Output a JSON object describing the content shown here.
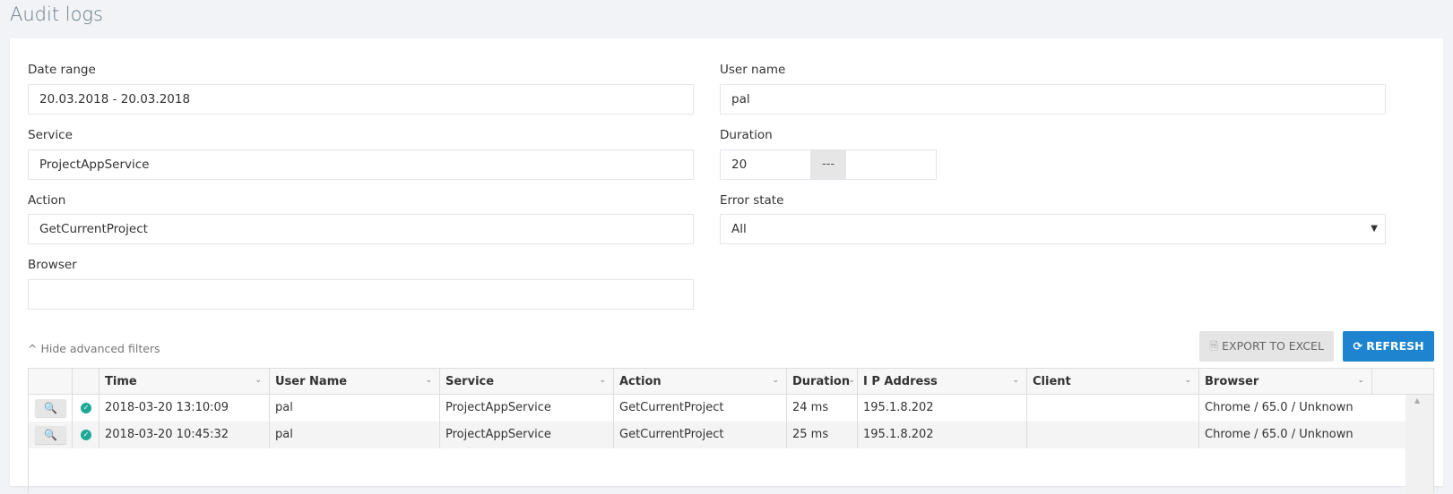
{
  "page": {
    "title": "Audit logs"
  },
  "filters": {
    "date_range": {
      "label": "Date range",
      "value": "20.03.2018 - 20.03.2018"
    },
    "user_name": {
      "label": "User name",
      "value": "pal"
    },
    "service": {
      "label": "Service",
      "value": "ProjectAppService"
    },
    "duration": {
      "label": "Duration",
      "from": "20",
      "separator": "---",
      "to": ""
    },
    "action": {
      "label": "Action",
      "value": "GetCurrentProject"
    },
    "error_state": {
      "label": "Error state",
      "value": "All"
    },
    "browser": {
      "label": "Browser",
      "value": ""
    },
    "toggle_label": "Hide advanced filters"
  },
  "toolbar": {
    "export_label": "EXPORT TO EXCEL",
    "refresh_label": "REFRESH",
    "accent": "#1e84cf"
  },
  "table": {
    "columns": [
      "Time",
      "User Name",
      "Service",
      "Action",
      "Duration",
      "I P Address",
      "Client",
      "Browser"
    ],
    "rows": [
      {
        "status": "success",
        "time": "2018-03-20 13:10:09",
        "user": "pal",
        "service": "ProjectAppService",
        "action": "GetCurrentProject",
        "duration": "24 ms",
        "ip": "195.1.8.202",
        "client": "",
        "browser": "Chrome / 65.0 / Unknown"
      },
      {
        "status": "success",
        "time": "2018-03-20 10:45:32",
        "user": "pal",
        "service": "ProjectAppService",
        "action": "GetCurrentProject",
        "duration": "25 ms",
        "ip": "195.1.8.202",
        "client": "",
        "browser": "Chrome / 65.0 / Unknown"
      }
    ]
  }
}
